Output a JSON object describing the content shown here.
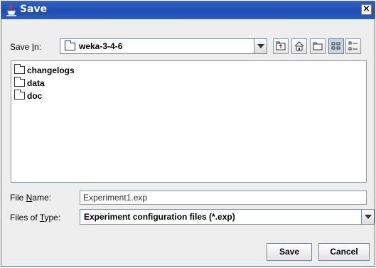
{
  "dialog": {
    "title": "Save",
    "close_glyph": "×"
  },
  "save_in": {
    "label": "Save ",
    "mnemonic": "I",
    "label_rest": "n:",
    "value": "weka-3-4-6"
  },
  "toolbar": {
    "icons": [
      "up-one-level-icon",
      "home-icon",
      "new-folder-icon",
      "list-view-icon",
      "details-view-icon"
    ]
  },
  "files": [
    {
      "name": "changelogs"
    },
    {
      "name": "data"
    },
    {
      "name": "doc"
    }
  ],
  "file_name": {
    "label": "File ",
    "mnemonic": "N",
    "label_rest": "ame:",
    "value": "Experiment1.exp"
  },
  "file_type": {
    "label": "Files of ",
    "mnemonic": "T",
    "label_rest": "ype:",
    "value": "Experiment configuration files (*.exp)"
  },
  "buttons": {
    "save": "Save",
    "cancel": "Cancel"
  }
}
